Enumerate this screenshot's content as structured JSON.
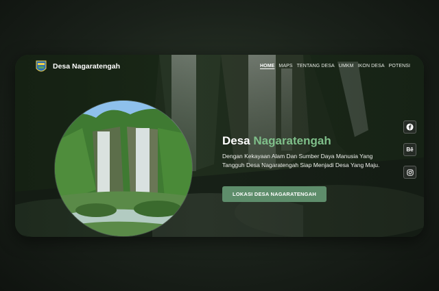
{
  "header": {
    "brand": "Desa Nagaratengah",
    "menu": [
      {
        "label": "HOME"
      },
      {
        "label": "MAPS"
      },
      {
        "label": "TENTANG DESA"
      },
      {
        "label": "UMKM"
      },
      {
        "label": "IKON DESA"
      },
      {
        "label": "POTENSI"
      }
    ]
  },
  "hero": {
    "title_part1": "Desa",
    "title_part2": "Nagaratengah",
    "description": "Dengan Kekayaan Alam Dan Sumber Daya Manusia Yang Tangguh Desa Nagaratengah Siap Menjadi Desa Yang Maju.",
    "cta_label": "LOKASI DESA NAGARATENGAH"
  },
  "social": [
    {
      "name": "facebook-icon",
      "glyph": "f"
    },
    {
      "name": "behance-icon",
      "glyph": "Bē"
    },
    {
      "name": "instagram-icon",
      "glyph": ""
    }
  ],
  "colors": {
    "accent": "#7fbf8a",
    "button": "#5e8d6b"
  }
}
